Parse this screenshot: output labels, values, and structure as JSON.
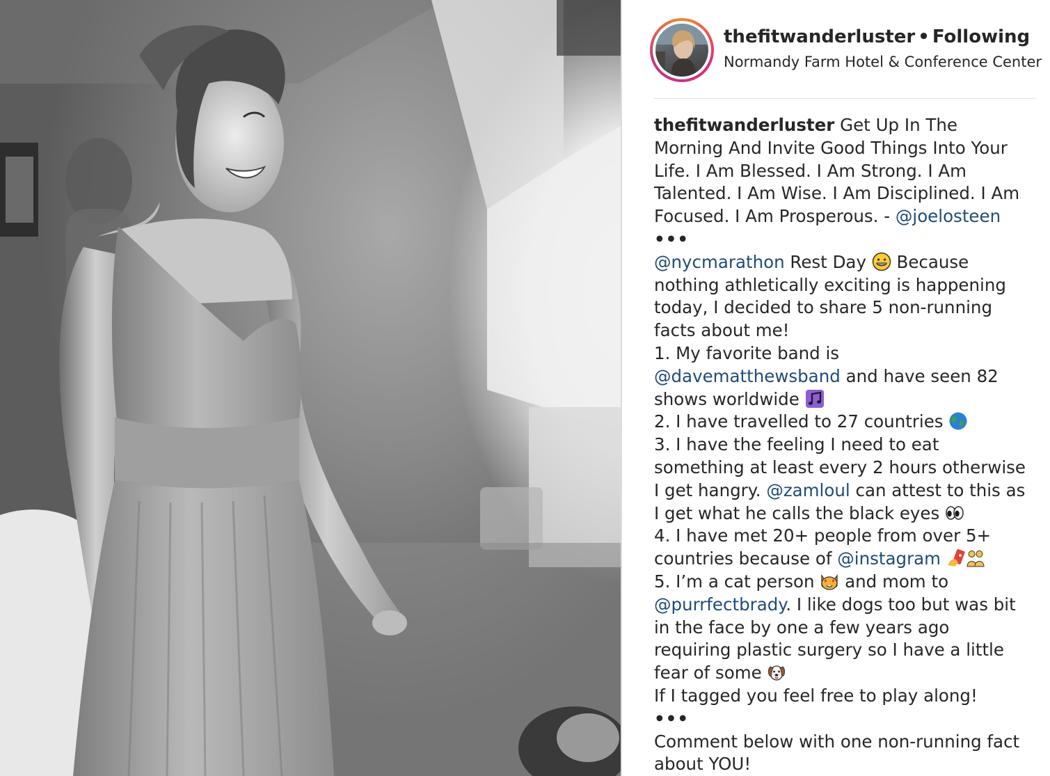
{
  "header": {
    "username": "thefitwanderluster",
    "separator": "•",
    "follow_status": "Following",
    "location": "Normandy Farm Hotel & Conference Center"
  },
  "caption": {
    "username": "thefitwanderluster",
    "intro": " Get Up In The Morning And Invite Good Things Into Your Life. I Am Blessed. I Am Strong. I Am Talented. I Am Wise. I Am Disciplined. I Am Focused. I Am Prosperous. - ",
    "mention_joel": "@joelosteen",
    "dots1": "•••",
    "mention_nyc": "@nycmarathon",
    "rest_day": " Rest Day ",
    "because": " Because nothing athletically exciting is happening today, I decided to share 5 non-running facts about me!",
    "fact1_a": "1. My favorite band is ",
    "mention_dmb": "@davematthewsband",
    "fact1_b": " and have seen 82 shows worldwide ",
    "fact2": "2. I have travelled to 27 countries ",
    "fact3_a": "3. I have the feeling I need to eat something at least every 2 hours otherwise I get hangry. ",
    "mention_zamloul": "@zamloul",
    "fact3_b": " can attest to this as I get what he calls the black eyes ",
    "fact4_a": "4. I have met 20+ people from over 5+ countries because of ",
    "mention_instagram": "@instagram",
    "fact5_a": "5. I’m a cat person ",
    "fact5_b": " and mom to ",
    "mention_brady": "@purrfectbrady",
    "fact5_c": ". I like dogs too but was bit in the face by one a few years ago requiring plastic surgery so I have a little fear of some ",
    "tagged": "If I tagged you feel free to play along!",
    "dots2": "•••",
    "closing": "Comment below with one non-running fact about YOU!"
  },
  "icons": {
    "grin": "grinning-face-icon",
    "music": "musical-notes-icon",
    "globe": "globe-icon",
    "eyes": "eyes-icon",
    "selfie": "selfie-icon",
    "people": "people-icon",
    "cat": "heart-eyes-cat-icon",
    "dog": "dog-face-icon"
  },
  "colors": {
    "mention": "#1f4b7a",
    "text": "#262626",
    "avatar_ring_start": "#f58529",
    "avatar_ring_end": "#dd2a7b"
  }
}
